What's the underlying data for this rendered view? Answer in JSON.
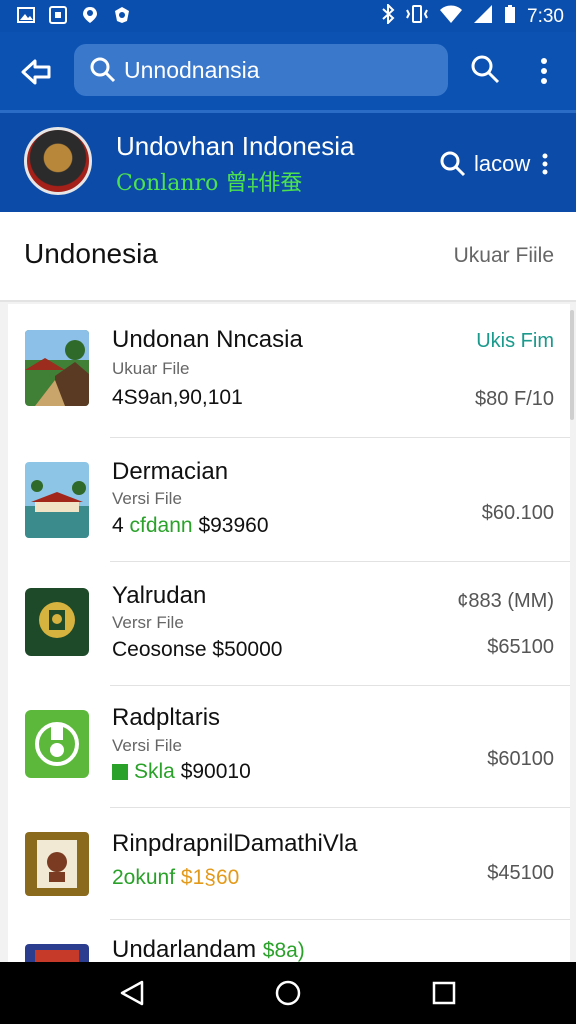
{
  "status_bar": {
    "left_icons": [
      "image-icon",
      "screenshot-icon",
      "location-icon",
      "shield-icon"
    ],
    "right_icons": [
      "bluetooth-icon",
      "vibrate-icon",
      "wifi-icon",
      "signal-icon",
      "battery-icon"
    ],
    "time": "7:30"
  },
  "app_bar": {
    "search_value": "Unnodnansia",
    "search_placeholder": "Unnodnansia"
  },
  "header": {
    "title": "Undovhan Indonesia",
    "subtitle": "Conlanro 曾‡俳蚕",
    "action_label": "lacow"
  },
  "section": {
    "title": "Undonesia",
    "link": "Ukuar Fiile"
  },
  "list": {
    "items": [
      {
        "title": "Undonan Nncasia",
        "sub": "Ukuar File",
        "meta": "4S9an,90,101",
        "right": "Ukis Fim",
        "right2": "$80 F/10"
      },
      {
        "title": "Dermacian",
        "sub": "Versi File",
        "meta_prefix": "4",
        "meta_green": "cfdann",
        "meta_rest": "$93960",
        "right": "$60.100"
      },
      {
        "title": "Yalrudan",
        "sub": "Versr File",
        "meta": "Ceosonse $50000",
        "right": "¢883 (MM)",
        "right2": "$65100"
      },
      {
        "title": "Radpltaris",
        "sub": "Versi File",
        "meta_green": "Skla",
        "meta_rest": "$90010",
        "right": "$60100"
      },
      {
        "title": "RinpdrapnilDamathiVla",
        "sub": "",
        "meta_green": "2okunf",
        "meta_orange": "$1§60",
        "right": "$45100"
      },
      {
        "title": "Undarlandam",
        "sub": "",
        "meta_green": "$8a)",
        "right": ""
      }
    ]
  },
  "nav_bar": {
    "buttons": [
      "back-icon",
      "home-icon",
      "recents-icon"
    ]
  }
}
